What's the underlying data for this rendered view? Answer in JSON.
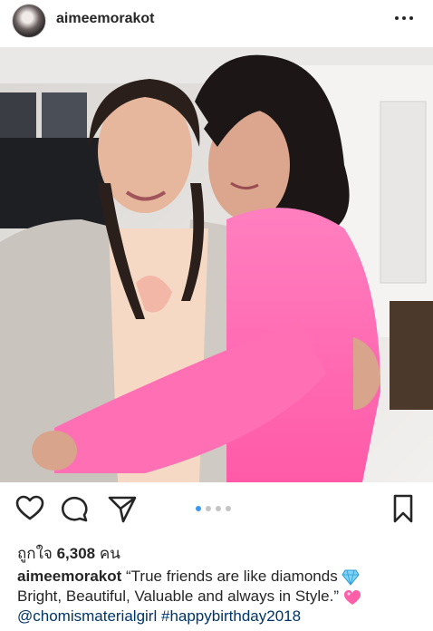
{
  "post": {
    "username": "aimeemorakot",
    "likes_label": "ถูกใจ",
    "likes_count": "6,308",
    "likes_unit": "คน",
    "carousel": {
      "total": 4,
      "active": 1
    },
    "caption": {
      "username": "aimeemorakot",
      "line1": "“True friends are like diamonds",
      "line2": "Bright, Beautiful, Valuable and always in Style.”",
      "mention": "@chomismaterialgirl",
      "hashtag": "#happybirthday2018"
    }
  },
  "icons": {
    "header_more": "more-horizontal-icon",
    "like": "heart-icon",
    "comment": "comment-icon",
    "share": "paper-plane-icon",
    "save": "bookmark-icon",
    "emoji1": "gem-emoji",
    "emoji2": "pink-heart-emoji"
  },
  "colors": {
    "text": "#262626",
    "link": "#003569",
    "dot_active": "#3897f0",
    "dot_inactive": "#c4c4c4"
  }
}
